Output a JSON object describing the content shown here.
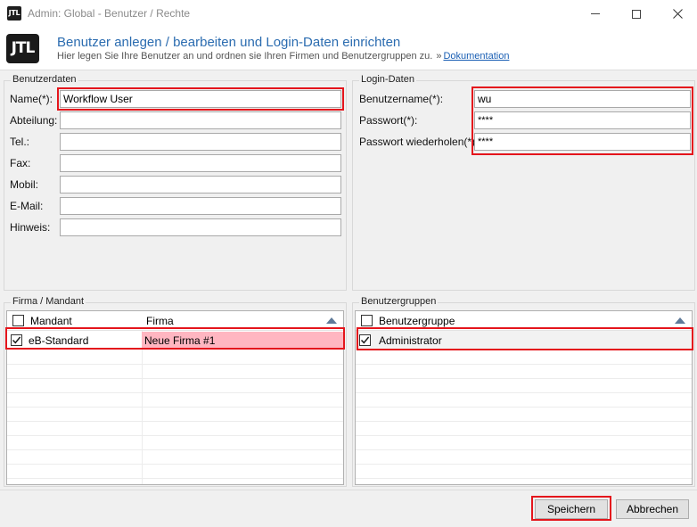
{
  "window": {
    "title": "Admin: Global - Benutzer / Rechte",
    "app_icon_text": "JTL"
  },
  "header": {
    "logo_text": "JTL",
    "title": "Benutzer anlegen / bearbeiten und Login-Daten einrichten",
    "subtitle": "Hier legen Sie Ihre Benutzer an und ordnen sie Ihren Firmen und Benutzergruppen zu.",
    "link_prefix": "»",
    "link_label": "Dokumentation"
  },
  "benutzerdaten": {
    "title": "Benutzerdaten",
    "fields": [
      {
        "label": "Name(*):",
        "value": "Workflow User"
      },
      {
        "label": "Abteilung:",
        "value": ""
      },
      {
        "label": "Tel.:",
        "value": ""
      },
      {
        "label": "Fax:",
        "value": ""
      },
      {
        "label": "Mobil:",
        "value": ""
      },
      {
        "label": "E-Mail:",
        "value": ""
      },
      {
        "label": "Hinweis:",
        "value": ""
      }
    ]
  },
  "login": {
    "title": "Login-Daten",
    "fields": [
      {
        "label": "Benutzername(*):",
        "value": "wu"
      },
      {
        "label": "Passwort(*):",
        "value": "****"
      },
      {
        "label": "Passwort wiederholen(*):",
        "value": "****"
      }
    ]
  },
  "firma": {
    "title": "Firma / Mandant",
    "columns": [
      "Mandant",
      "Firma"
    ],
    "rows": [
      {
        "mandant": "eB-Standard",
        "firma": "Neue Firma #1",
        "checked": true
      }
    ],
    "highlight_color": "#ffb6c1"
  },
  "gruppen": {
    "title": "Benutzergruppen",
    "columns": [
      "Benutzergruppe"
    ],
    "rows": [
      {
        "name": "Administrator",
        "checked": true
      }
    ]
  },
  "buttons": {
    "save": "Speichern",
    "cancel": "Abbrechen"
  },
  "colors": {
    "accent_title": "#2b6cb0",
    "highlight_border": "#e4151c"
  }
}
